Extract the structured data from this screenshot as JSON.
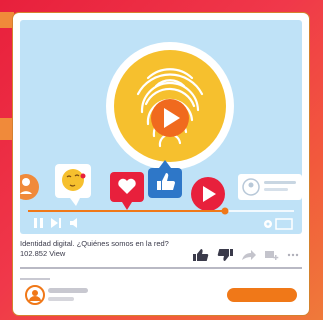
{
  "video": {
    "caption": "Identidad digital. ¿Quiénes somos en la red?",
    "views": "102.852 View",
    "progress": 0.74
  },
  "icons": [
    "fingerprint-icon",
    "play-icon",
    "heart-icon",
    "like-icon",
    "kiss-emoji-icon",
    "profile-icon",
    "pause-icon",
    "next-icon",
    "volume-icon",
    "settings-icon",
    "fullscreen-icon",
    "thumbs-up-icon",
    "thumbs-down-icon",
    "share-icon",
    "add-playlist-icon",
    "more-icon",
    "avatar-icon"
  ],
  "colors": {
    "accent": "#f07818",
    "red": "#e8203c",
    "blue": "#2e77c8",
    "yellow": "#f6c02e",
    "sky": "#bfe2f7"
  }
}
